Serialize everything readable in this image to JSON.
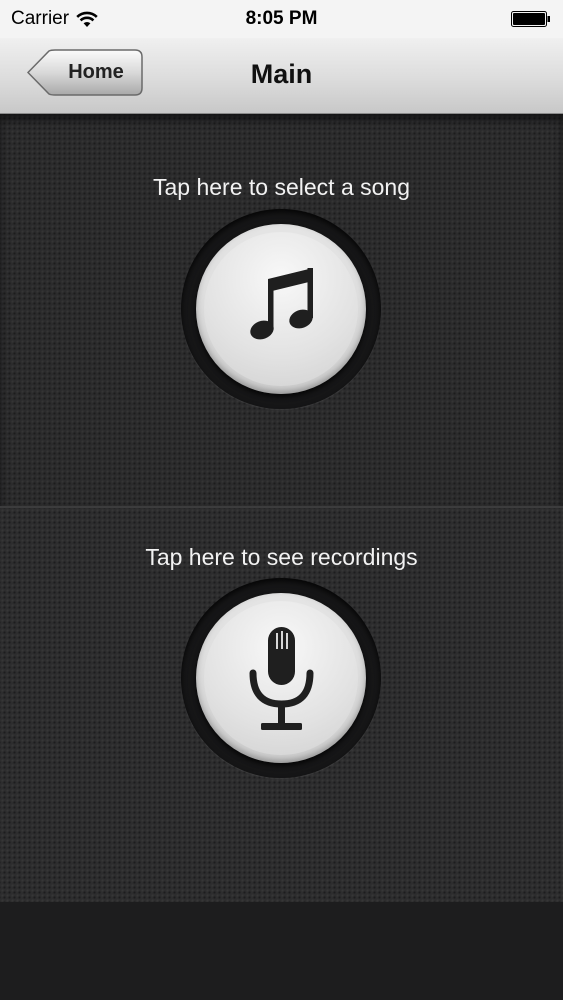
{
  "status_bar": {
    "carrier": "Carrier",
    "time": "8:05 PM",
    "icons": [
      "wifi-icon",
      "battery-icon"
    ]
  },
  "nav_bar": {
    "back_label": "Home",
    "title": "Main"
  },
  "song_panel": {
    "label": "Tap here to select a song",
    "icon": "music-note-icon"
  },
  "recordings_panel": {
    "label": "Tap here to see recordings",
    "icon": "microphone-icon"
  },
  "colors": {
    "background": "#2a2a2b",
    "nav_bar": "#dcdcdc",
    "button_face": "#e2e2e2",
    "icon": "#222222",
    "label_text": "#f2f2f2"
  }
}
